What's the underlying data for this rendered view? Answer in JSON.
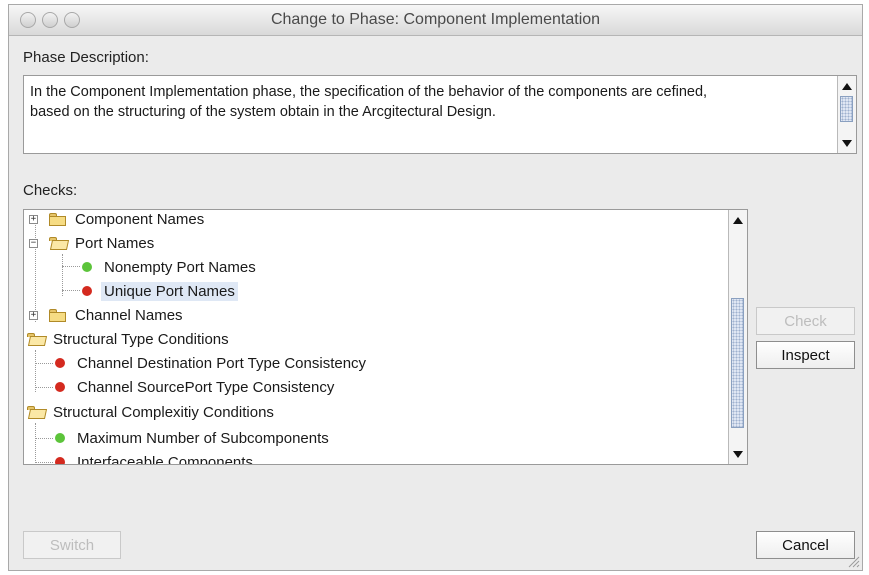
{
  "window": {
    "title": "Change to Phase: Component Implementation"
  },
  "phase_description": {
    "label": "Phase Description:",
    "text_line1": "In the Component Implementation phase, the specification of the behavior of the components are cefined,",
    "text_line2": "based on the structuring of the system obtain in the Arcgitectural Design."
  },
  "checks": {
    "label": "Checks:",
    "tree": [
      {
        "label": "Component Names",
        "kind": "folder",
        "state": "collapsed"
      },
      {
        "label": "Port Names",
        "kind": "folder",
        "state": "expanded"
      },
      {
        "label": "Nonempty Port Names",
        "kind": "check",
        "status": "green"
      },
      {
        "label": "Unique Port Names",
        "kind": "check",
        "status": "red",
        "selected": true
      },
      {
        "label": "Channel Names",
        "kind": "folder",
        "state": "collapsed"
      },
      {
        "label": "Structural Type Conditions",
        "kind": "folder",
        "state": "expanded"
      },
      {
        "label": "Channel Destination Port Type Consistency",
        "kind": "check",
        "status": "red"
      },
      {
        "label": "Channel SourcePort Type Consistency",
        "kind": "check",
        "status": "red"
      },
      {
        "label": "Structural Complexitiy Conditions",
        "kind": "folder",
        "state": "expanded"
      },
      {
        "label": "Maximum Number of Subcomponents",
        "kind": "check",
        "status": "green"
      },
      {
        "label": "Interfaceable Components",
        "kind": "check",
        "status": "red"
      }
    ]
  },
  "buttons": {
    "check": "Check",
    "inspect": "Inspect",
    "switch": "Switch",
    "cancel": "Cancel"
  },
  "colors": {
    "status_green": "#5cc43a",
    "status_red": "#d42a1f",
    "selection": "#dfe8f5"
  }
}
